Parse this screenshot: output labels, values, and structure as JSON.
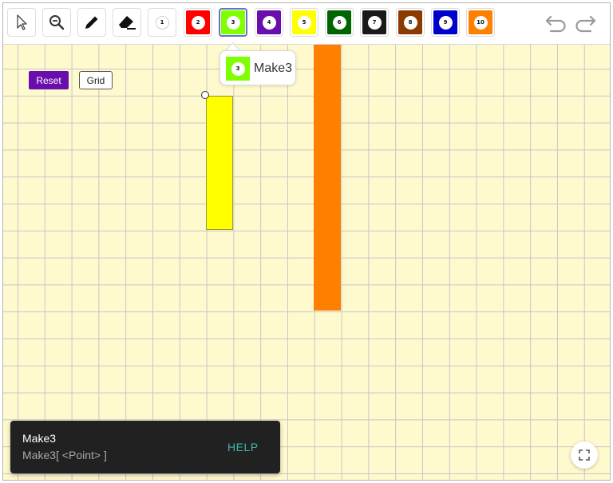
{
  "toolbar": {
    "tools": [
      {
        "name": "move-tool",
        "icon": "cursor-arrow-icon"
      },
      {
        "name": "zoom-out-tool",
        "icon": "zoom-out-icon"
      },
      {
        "name": "pen-tool",
        "icon": "pen-icon"
      },
      {
        "name": "eraser-tool",
        "icon": "eraser-icon"
      }
    ],
    "make_tools": [
      {
        "label": "1",
        "color": "#ffffff"
      },
      {
        "label": "2",
        "color": "#ff0000"
      },
      {
        "label": "3",
        "color": "#7fff00",
        "selected": true
      },
      {
        "label": "4",
        "color": "#6a0dad"
      },
      {
        "label": "5",
        "color": "#ffff00"
      },
      {
        "label": "6",
        "color": "#006400"
      },
      {
        "label": "7",
        "color": "#1a1a1a"
      },
      {
        "label": "8",
        "color": "#8b3a00"
      },
      {
        "label": "9",
        "color": "#0000cd"
      },
      {
        "label": "10",
        "color": "#ff7f00"
      }
    ],
    "undo_icon": "undo-icon",
    "redo_icon": "redo-icon"
  },
  "canvas": {
    "reset_label": "Reset",
    "grid_label": "Grid",
    "rectangles": [
      {
        "color": "#ffff00"
      },
      {
        "color": "#ff7f00"
      }
    ]
  },
  "tooltip": {
    "label": "Make3",
    "ball_label": "3"
  },
  "help": {
    "title": "Make3",
    "syntax": "Make3[ <Point> ]",
    "help_label": "HELP"
  },
  "fullscreen_icon": "fullscreen-icon"
}
